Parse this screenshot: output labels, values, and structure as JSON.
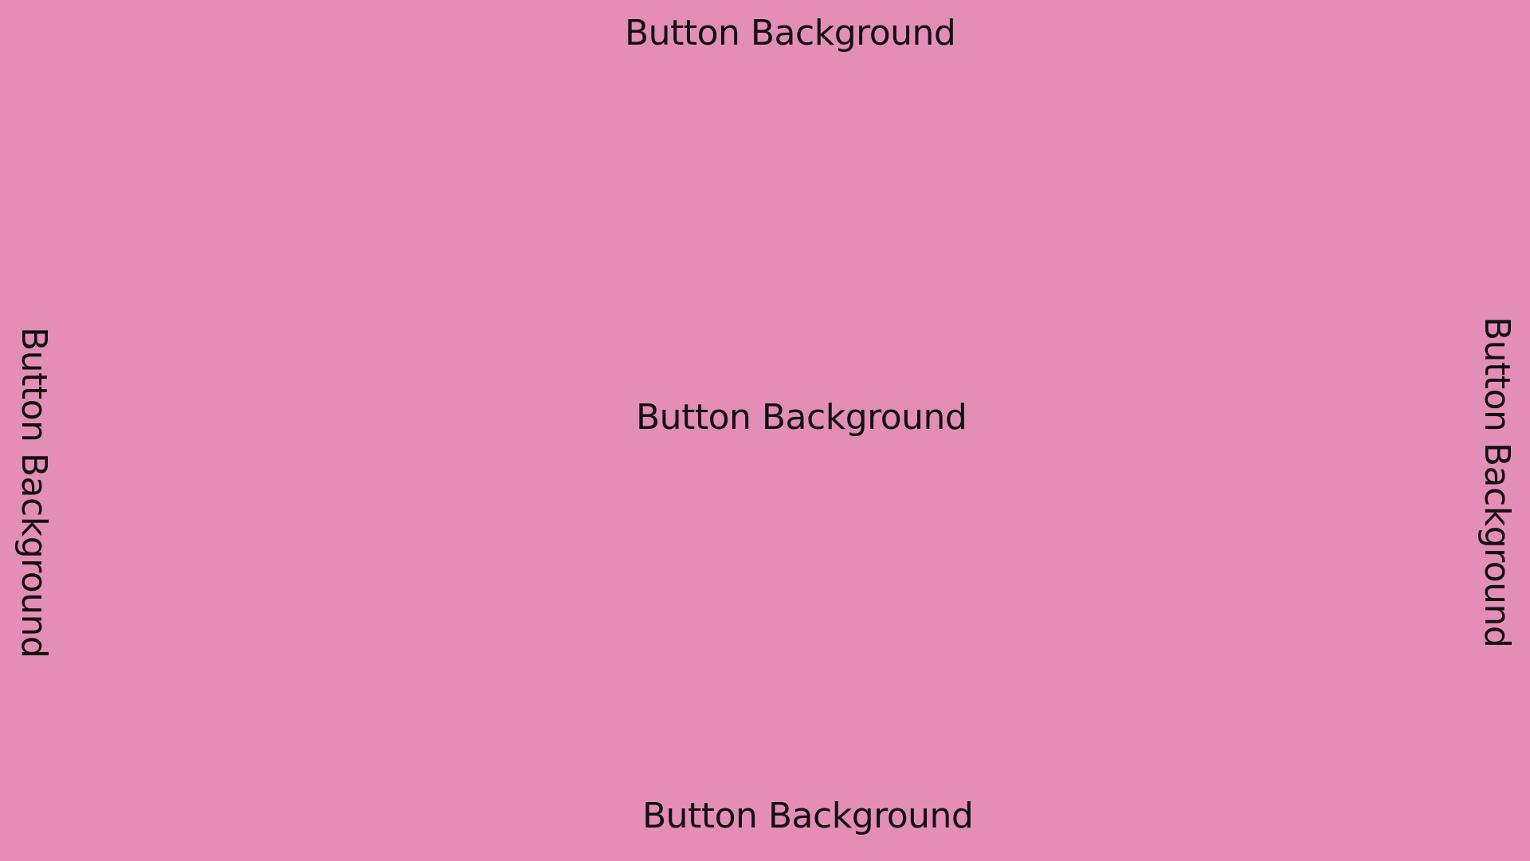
{
  "theme": {
    "background": "#e48db7",
    "text": "#111111"
  },
  "labels": {
    "top": "Button Background",
    "center": "Button Background",
    "bottom": "Button Background",
    "left": "Button Background",
    "right": "Button Background"
  }
}
